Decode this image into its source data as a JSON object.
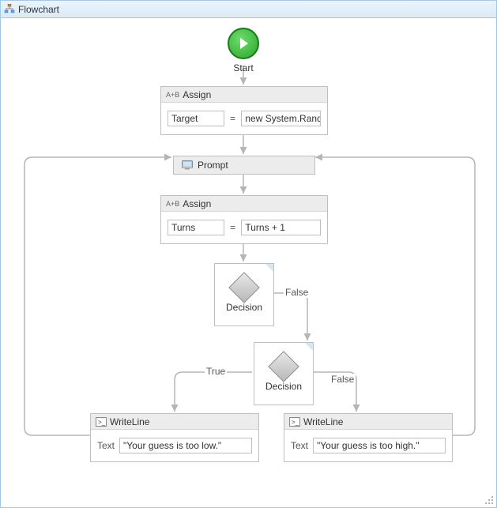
{
  "title": "Flowchart",
  "start": {
    "label": "Start"
  },
  "assign1": {
    "header": "Assign",
    "left": "Target",
    "right": "new System.Rando"
  },
  "prompt": {
    "label": "Prompt"
  },
  "assign2": {
    "header": "Assign",
    "left": "Turns",
    "right": "Turns + 1"
  },
  "decision1": {
    "label": "Decision"
  },
  "decision2": {
    "label": "Decision"
  },
  "edgeLabels": {
    "d1_false": "False",
    "d2_true": "True",
    "d2_false": "False"
  },
  "writeLow": {
    "header": "WriteLine",
    "textLabel": "Text",
    "value": "\"Your guess is too low.\""
  },
  "writeHigh": {
    "header": "WriteLine",
    "textLabel": "Text",
    "value": "\"Your guess is too high.\""
  },
  "icons": {
    "assign": "A+B"
  }
}
